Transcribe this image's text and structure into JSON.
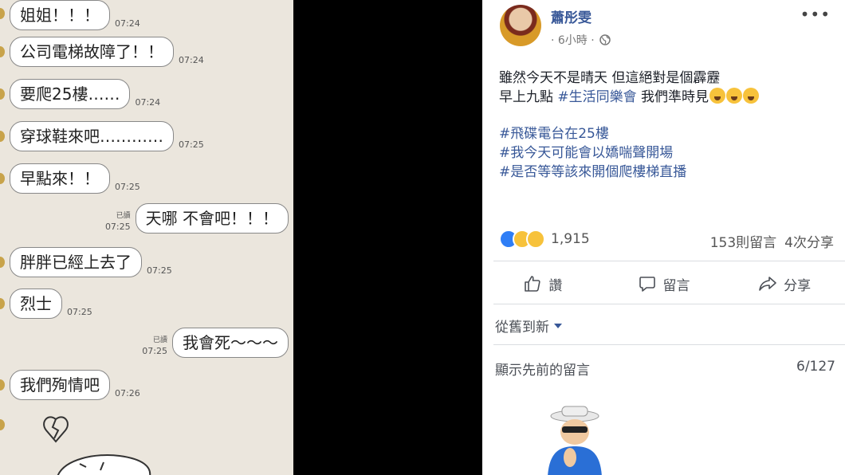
{
  "chat": {
    "messages": [
      {
        "text": "姐姐！！！",
        "time": "07:24"
      },
      {
        "text": "公司電梯故障了！！",
        "time": "07:24"
      },
      {
        "text": "要爬25樓……",
        "time": "07:24"
      },
      {
        "text": "穿球鞋來吧…………",
        "time": "07:25"
      },
      {
        "text": "早點來！！",
        "time": "07:25"
      },
      {
        "text": "天哪 不會吧！！！",
        "time": "07:25",
        "read": "已讀"
      },
      {
        "text": "胖胖已經上去了",
        "time": "07:25"
      },
      {
        "text": "烈士",
        "time": "07:25"
      },
      {
        "text": "我會死～～～",
        "time": "07:25",
        "read": "已讀"
      },
      {
        "text": "我們殉情吧",
        "time": "07:26"
      }
    ]
  },
  "post": {
    "author": "蕭彤雯",
    "time": "· 6小時 ·",
    "more_icon": "more-icon",
    "body": {
      "line1": "雖然今天不是晴天 但這絕對是個霹靂",
      "line2_pre": "早上九點 ",
      "line2_tag": "#生活同樂會",
      "line2_post": " 我們準時見",
      "tag1": "#飛碟電台在25樓",
      "tag2": "#我今天可能會以嬌喘聲開場",
      "tag3": "#是否等等該來開個爬樓梯直播"
    },
    "reactions_count": "1,915",
    "comments": "153則留言",
    "shares": "4次分享",
    "actions": {
      "like": "讚",
      "comment": "留言",
      "share": "分享"
    },
    "sort_label": "從舊到新",
    "previous_comments": "顯示先前的留言",
    "comment_count": "6/127"
  },
  "colors": {
    "link": "#385898",
    "chat_bg": "#ebe6dd"
  }
}
